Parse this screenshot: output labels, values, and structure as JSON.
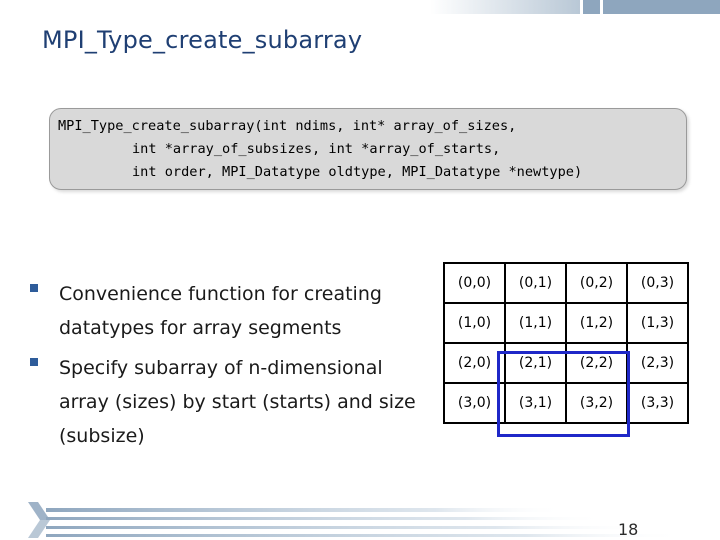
{
  "slide": {
    "title": "MPI_Type_create_subarray",
    "code": {
      "line1": "MPI_Type_create_subarray(int ndims, int* array_of_sizes,",
      "line2": "int *array_of_subsizes, int *array_of_starts,",
      "line3": "int order, MPI_Datatype oldtype, MPI_Datatype *newtype)"
    },
    "bullets": [
      "Convenience function for creating datatypes for array segments",
      "Specify subarray of n-dimensional array (sizes) by start (starts) and size (subsize)"
    ],
    "grid": [
      [
        "(0,0)",
        "(0,1)",
        "(0,2)",
        "(0,3)"
      ],
      [
        "(1,0)",
        "(1,1)",
        "(1,2)",
        "(1,3)"
      ],
      [
        "(2,0)",
        "(2,1)",
        "(2,2)",
        "(2,3)"
      ],
      [
        "(3,0)",
        "(3,1)",
        "(3,2)",
        "(3,3)"
      ]
    ],
    "page_number": "18"
  },
  "colors": {
    "title": "#1f3f73",
    "bullet_marker": "#2e5c9a",
    "highlight": "#1f28c8",
    "code_background": "#d9d9d9"
  }
}
